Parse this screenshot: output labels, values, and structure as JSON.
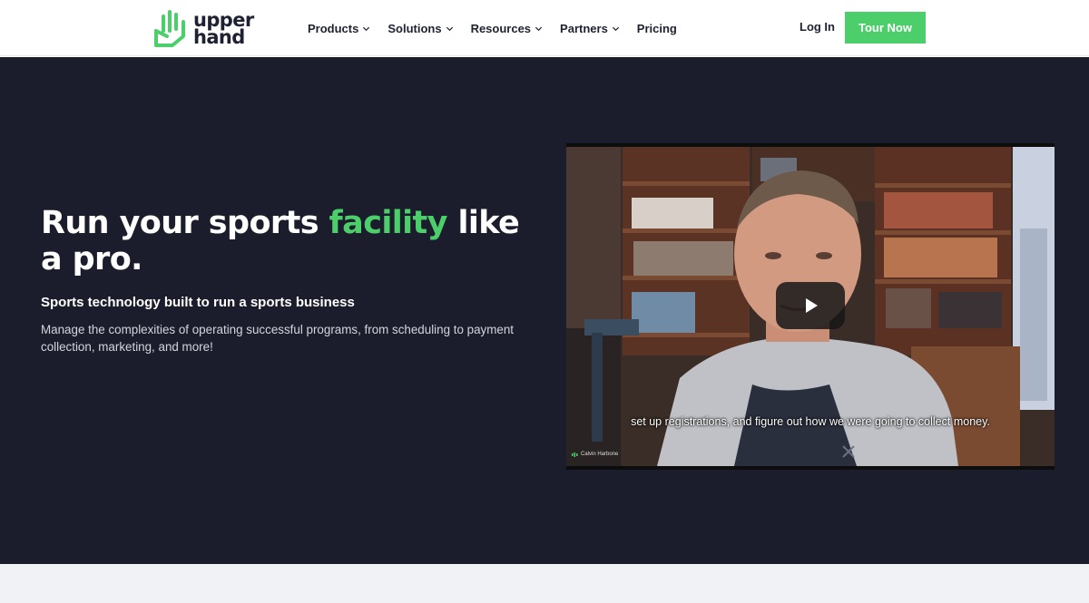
{
  "brand": {
    "name_line1": "upper",
    "name_line2": "hand",
    "accent_color": "#4ccf6a",
    "dark_color": "#1c1d2c"
  },
  "nav": {
    "items": [
      {
        "label": "Products",
        "has_dropdown": true
      },
      {
        "label": "Solutions",
        "has_dropdown": true
      },
      {
        "label": "Resources",
        "has_dropdown": true
      },
      {
        "label": "Partners",
        "has_dropdown": true
      },
      {
        "label": "Pricing",
        "has_dropdown": false
      }
    ],
    "login_label": "Log In",
    "cta_label": "Tour Now"
  },
  "hero": {
    "headline_before": "Run your sports ",
    "headline_accent": "facility",
    "headline_after": " like a pro.",
    "subheading": "Sports technology built to run a sports business",
    "description": "Manage the complexities of operating successful programs, from scheduling to payment collection, marketing, and more!"
  },
  "video": {
    "caption": "set up registrations, and figure out how we were going to collect money.",
    "speaker_label": "Calvin Harbone",
    "play_icon": "play-icon"
  }
}
